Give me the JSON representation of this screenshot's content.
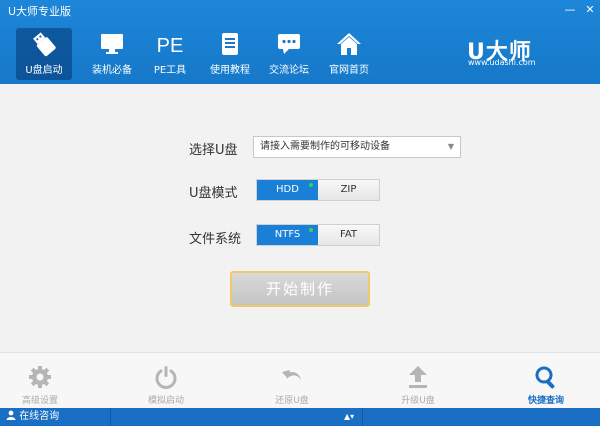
{
  "window": {
    "title": "U大师专业版",
    "minimize": "—",
    "close": "✕"
  },
  "colors": {
    "header": "#1a7fd6",
    "accent": "#1a7fd6",
    "indicator": "#3bd24a",
    "start_border": "#f0c96a"
  },
  "nav": {
    "items": [
      {
        "label": "U盘启动",
        "icon": "usb-drive-icon",
        "active": true
      },
      {
        "label": "装机必备",
        "icon": "monitor-icon",
        "active": false
      },
      {
        "label": "PE工具",
        "icon": "pe-text-icon",
        "active": false
      },
      {
        "label": "使用教程",
        "icon": "book-icon",
        "active": false
      },
      {
        "label": "交流论坛",
        "icon": "chat-bubble-icon",
        "active": false
      },
      {
        "label": "官网首页",
        "icon": "home-icon",
        "active": false
      }
    ]
  },
  "pe_icon_text": "PE",
  "logo": {
    "main": "U大师",
    "url": "www.udashi.com"
  },
  "form": {
    "select_label": "选择U盘",
    "select_value": "请接入需要制作的可移动设备",
    "mode_label": "U盘模式",
    "mode_options": [
      "HDD",
      "ZIP"
    ],
    "mode_selected": "HDD",
    "fs_label": "文件系统",
    "fs_options": [
      "NTFS",
      "FAT"
    ],
    "fs_selected": "NTFS",
    "start_button": "开始制作"
  },
  "bottom": {
    "tools": [
      {
        "label": "高级设置",
        "icon": "gear-icon",
        "active": false
      },
      {
        "label": "模拟启动",
        "icon": "power-icon",
        "active": false
      },
      {
        "label": "还原U盘",
        "icon": "undo-arrow-icon",
        "active": false
      },
      {
        "label": "升级U盘",
        "icon": "upload-arrow-icon",
        "active": false
      },
      {
        "label": "快捷查询",
        "icon": "search-icon",
        "active": true
      }
    ]
  },
  "status": {
    "left": "在线咨询",
    "middle": "▲▾",
    "right": ""
  }
}
